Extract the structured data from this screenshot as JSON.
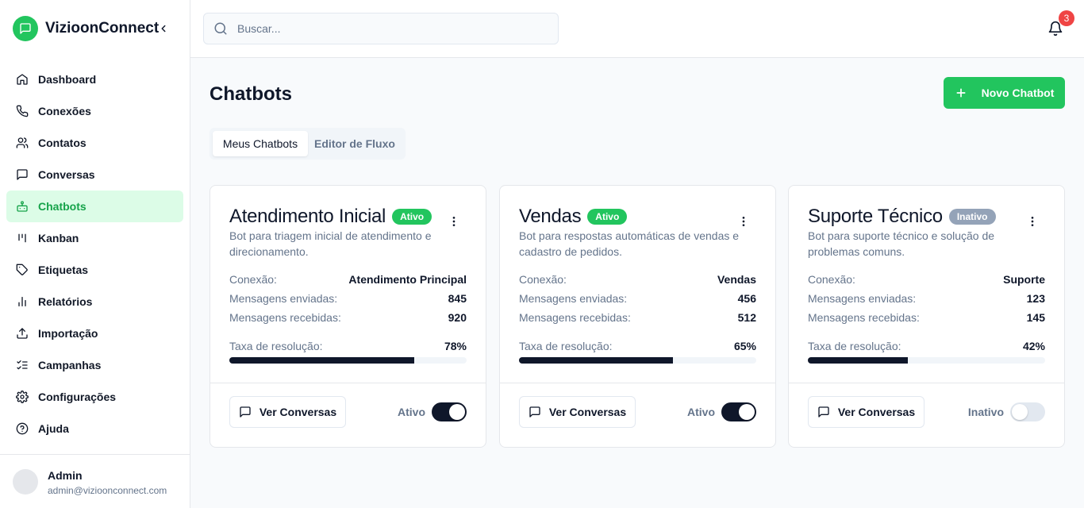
{
  "app": {
    "name": "VizioonConnect"
  },
  "sidebar": {
    "items": [
      {
        "label": "Dashboard",
        "icon": "home-icon"
      },
      {
        "label": "Conexões",
        "icon": "phone-icon"
      },
      {
        "label": "Contatos",
        "icon": "users-icon"
      },
      {
        "label": "Conversas",
        "icon": "message-square-icon"
      },
      {
        "label": "Chatbots",
        "icon": "bot-icon",
        "active": true
      },
      {
        "label": "Kanban",
        "icon": "kanban-icon"
      },
      {
        "label": "Etiquetas",
        "icon": "tag-icon"
      },
      {
        "label": "Relatórios",
        "icon": "bar-chart-icon"
      },
      {
        "label": "Importação",
        "icon": "upload-icon"
      },
      {
        "label": "Campanhas",
        "icon": "list-checks-icon"
      },
      {
        "label": "Configurações",
        "icon": "settings-icon"
      },
      {
        "label": "Ajuda",
        "icon": "help-circle-icon"
      }
    ],
    "user": {
      "name": "Admin",
      "email": "admin@vizioonconnect.com"
    }
  },
  "header": {
    "search_placeholder": "Buscar...",
    "notification_count": "3"
  },
  "main": {
    "title": "Chatbots",
    "new_button": "Novo Chatbot",
    "tabs": [
      {
        "label": "Meus Chatbots",
        "active": true
      },
      {
        "label": "Editor de Fluxo",
        "active": false
      }
    ]
  },
  "labels": {
    "connection": "Conexão:",
    "sent": "Mensagens enviadas:",
    "received": "Mensagens recebidas:",
    "resolution": "Taxa de resolução:",
    "view_conversations": "Ver Conversas"
  },
  "cards": [
    {
      "title": "Atendimento Inicial",
      "status": "Ativo",
      "active": true,
      "description": "Bot para triagem inicial de atendimento e direcionamento.",
      "connection": "Atendimento Principal",
      "sent": "845",
      "received": "920",
      "resolution": "78%",
      "resolution_value": 78,
      "toggle_label": "Ativo"
    },
    {
      "title": "Vendas",
      "status": "Ativo",
      "active": true,
      "description": "Bot para respostas automáticas de vendas e cadastro de pedidos.",
      "connection": "Vendas",
      "sent": "456",
      "received": "512",
      "resolution": "65%",
      "resolution_value": 65,
      "toggle_label": "Ativo"
    },
    {
      "title": "Suporte Técnico",
      "status": "Inativo",
      "active": false,
      "description": "Bot para suporte técnico e solução de problemas comuns.",
      "connection": "Suporte",
      "sent": "123",
      "received": "145",
      "resolution": "42%",
      "resolution_value": 42,
      "toggle_label": "Inativo"
    }
  ],
  "colors": {
    "accent": "#22c55e",
    "accent_light": "#dcfce7",
    "dark": "#0f172a",
    "muted": "#64748b",
    "inactive": "#94a3b8",
    "notification": "#ef4444"
  }
}
